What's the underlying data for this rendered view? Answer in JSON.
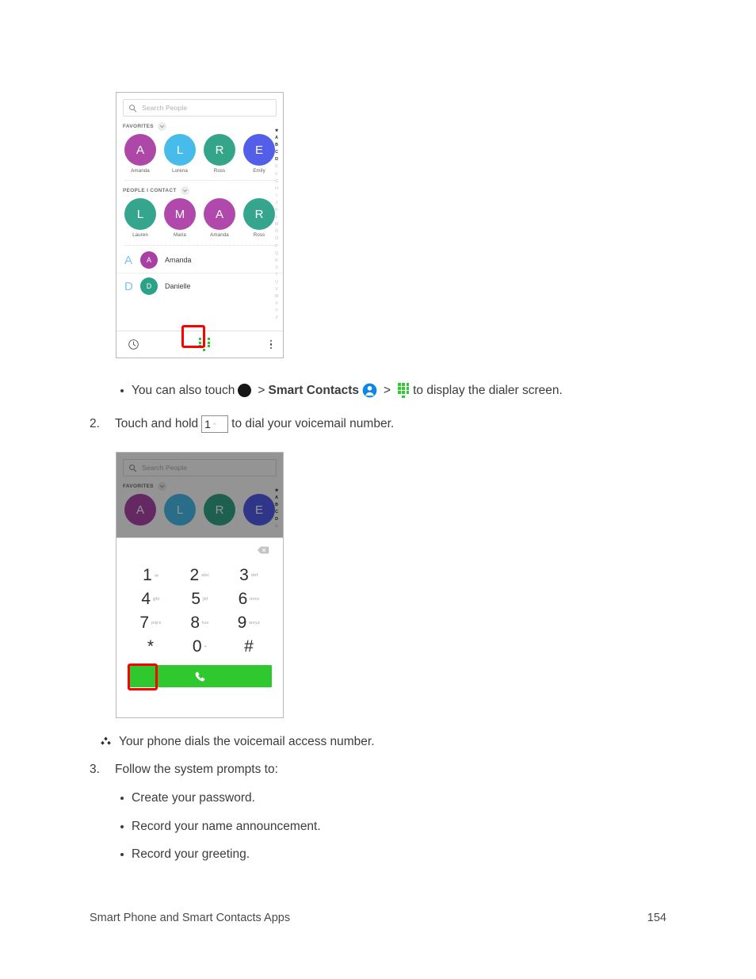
{
  "document": {
    "footer_left": "Smart Phone and Smart Contacts Apps",
    "footer_page": "154",
    "bullet_1": {
      "text_before": "You can also touch",
      "gt1": ">",
      "bold_label": "Smart Contacts",
      "gt2": ">",
      "text_after": "to display the dialer screen.",
      "icons": [
        "apps-grid-icon",
        "blue-contact-icon",
        "green-dialpad-icon"
      ]
    },
    "step_2": {
      "number": "2.",
      "text_before": "Touch and hold",
      "key_icon_number": "1",
      "key_icon_sub": "∞",
      "text_after": "to dial your voicemail number."
    },
    "note": {
      "bullet_icon": "diamond-cluster-icon",
      "text": "Your phone dials the voicemail access number."
    },
    "step_3": {
      "number": "3.",
      "text": "Follow the system prompts to:",
      "sub_bullets": [
        "Create your password.",
        "Record your name announcement.",
        "Record your greeting."
      ]
    }
  },
  "contacts_screen": {
    "search": {
      "placeholder": "Search People",
      "icon": "search-icon"
    },
    "sections": [
      {
        "title": "FAVORITES",
        "chevron": "chevron-down-icon",
        "contacts": [
          {
            "initial": "A",
            "name": "Amanda",
            "color": "#a93fa5"
          },
          {
            "initial": "L",
            "name": "Lorena",
            "color": "#3eb9ea"
          },
          {
            "initial": "R",
            "name": "Ross",
            "color": "#2ba184"
          },
          {
            "initial": "E",
            "name": "Emily",
            "color": "#4a56e8"
          }
        ]
      },
      {
        "title": "PEOPLE I CONTACT",
        "chevron": "chevron-down-icon",
        "contacts": [
          {
            "initial": "L",
            "name": "Lauren",
            "color": "#2ba187"
          },
          {
            "initial": "M",
            "name": "Maria",
            "color": "#ad3fa8"
          },
          {
            "initial": "A",
            "name": "Amanda",
            "color": "#ad3fa8"
          },
          {
            "initial": "R",
            "name": "Ross",
            "color": "#2ba187"
          }
        ]
      }
    ],
    "list_rows": [
      {
        "index_letter": "A",
        "initial": "A",
        "name": "Amanda",
        "color": "#a93fa5"
      },
      {
        "index_letter": "D",
        "initial": "D",
        "name": "Danielle",
        "color": "#2ba187"
      }
    ],
    "alpha_index": [
      "★",
      "A",
      "B",
      "C",
      "D",
      "E",
      "F",
      "G",
      "H",
      "I",
      "J",
      "K",
      "L",
      "M",
      "N",
      "O",
      "P",
      "Q",
      "R",
      "S",
      "T",
      "U",
      "V",
      "W",
      "X",
      "Y",
      "Z"
    ],
    "alpha_index_active": [
      "★",
      "A",
      "B",
      "C",
      "D"
    ],
    "bottom_nav": {
      "left_icon": "clock-history-icon",
      "center_icon": "dialpad-icon",
      "right_icon": "overflow-menu-icon",
      "highlight": "red-box-dialpad"
    }
  },
  "dialer_screen": {
    "search": {
      "placeholder": "Search People",
      "icon": "search-icon"
    },
    "section_title": "FAVORITES",
    "chevron": "chevron-down-icon",
    "contacts": [
      {
        "initial": "A",
        "color": "#a93fa5"
      },
      {
        "initial": "L",
        "color": "#3eb9ea"
      },
      {
        "initial": "R",
        "color": "#2ba184"
      },
      {
        "initial": "E",
        "color": "#4a56e8"
      }
    ],
    "alpha_index": [
      "★",
      "A",
      "B",
      "C",
      "D",
      "E"
    ],
    "backspace_icon": "backspace-icon",
    "keys": [
      {
        "num": "1",
        "sub": "∞",
        "highlight": true
      },
      {
        "num": "2",
        "sub": "abc",
        "highlight": false
      },
      {
        "num": "3",
        "sub": "def",
        "highlight": false
      },
      {
        "num": "4",
        "sub": "ghi",
        "highlight": false
      },
      {
        "num": "5",
        "sub": "jkl",
        "highlight": false
      },
      {
        "num": "6",
        "sub": "mno",
        "highlight": false
      },
      {
        "num": "7",
        "sub": "pqrs",
        "highlight": false
      },
      {
        "num": "8",
        "sub": "tuv",
        "highlight": false
      },
      {
        "num": "9",
        "sub": "wxyz",
        "highlight": false
      },
      {
        "num": "*",
        "sub": "",
        "highlight": false
      },
      {
        "num": "0",
        "sub": "+",
        "highlight": false
      },
      {
        "num": "#",
        "sub": "",
        "highlight": false
      }
    ],
    "call_button": {
      "icon": "phone-handset-icon",
      "color": "#2fc92f"
    }
  },
  "colors": {
    "highlight_red": "#fe0000",
    "call_green": "#2fc92f",
    "dialpad_green": "#2ecc2e",
    "index_letter_blue": "#7ec3f0"
  }
}
